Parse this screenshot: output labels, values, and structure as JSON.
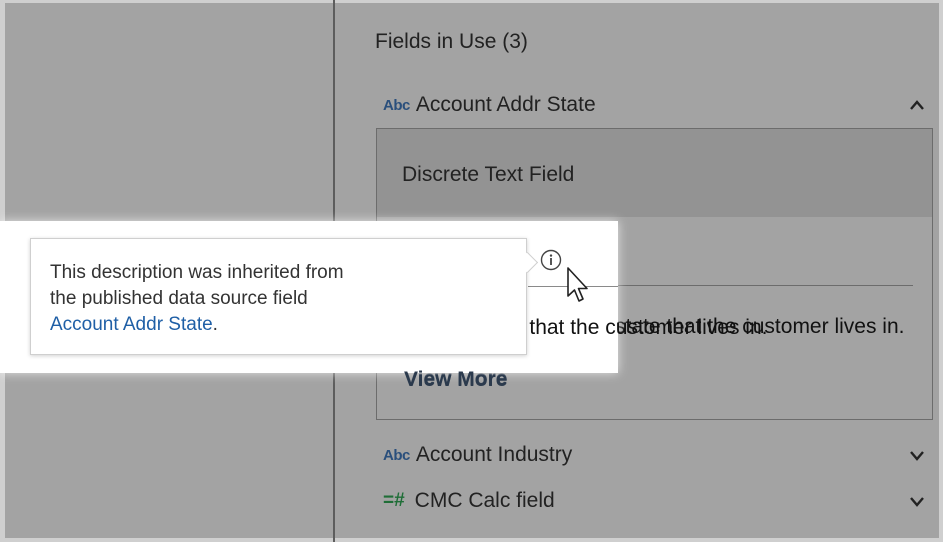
{
  "panel": {
    "title": "Fields in Use (3)"
  },
  "fields": [
    {
      "type_icon": "Abc",
      "name": "Account Addr State",
      "expanded": true
    },
    {
      "type_icon": "Abc",
      "name": "Account Industry",
      "expanded": false
    },
    {
      "type_icon": "=#",
      "name": "CMC Calc field",
      "expanded": false
    }
  ],
  "expanded_field": {
    "kind": "Discrete Text Field",
    "description": "state that the customer lives in.",
    "view_more": "View More"
  },
  "tooltip": {
    "line1": "This description was inherited from",
    "line2": "the published data source field",
    "link": "Account Addr State",
    "link_suffix": "."
  },
  "icons": {
    "info": "info-icon",
    "chevron_up": "chevron-up-icon",
    "chevron_down": "chevron-down-icon",
    "cursor": "pointer-cursor"
  }
}
